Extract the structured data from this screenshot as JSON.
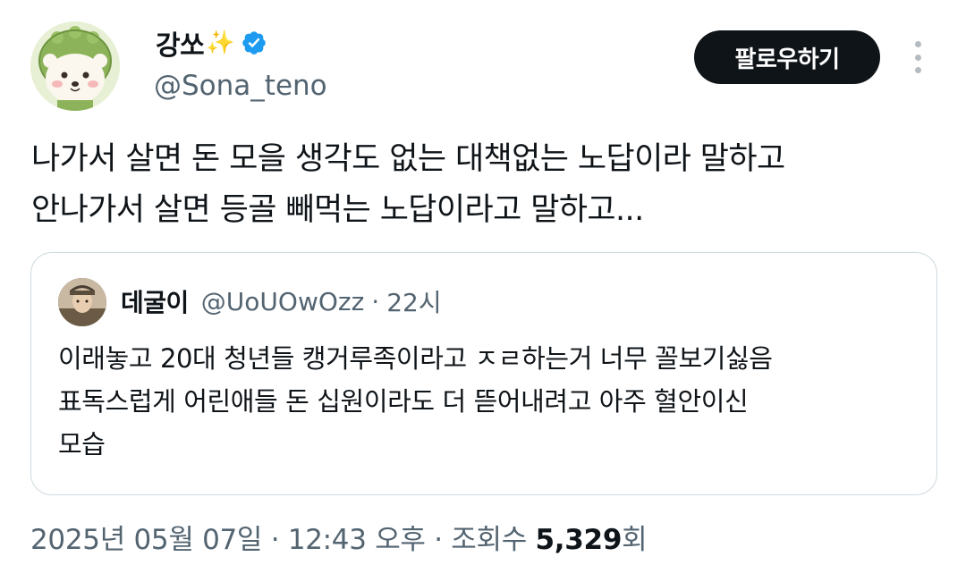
{
  "author": {
    "display_name": "강쏘",
    "sparkle_emoji": "✨",
    "handle": "@Sona_teno",
    "verified": true,
    "follow_label": "팔로우하기"
  },
  "tweet": {
    "lines": [
      "나가서 살면 돈 모을 생각도 없는 대책없는 노답이라 말하고",
      "안나가서 살면 등골 빼먹는 노답이라고 말하고..."
    ]
  },
  "quote": {
    "display_name": "데굴이",
    "handle": "@UoUOwOzz",
    "separator": "·",
    "time": "22시",
    "lines": [
      "이래놓고 20대 청년들 캥거루족이라고 ㅈㄹ하는거 너무 꼴보기싫음",
      "표독스럽게 어린애들 돈 십원이라도 더 뜯어내려고 아주 혈안이신",
      "모습"
    ]
  },
  "meta": {
    "datetime": "2025년 05월 07일 · 12:43 오후 · 조회수 ",
    "views": "5,329",
    "views_suffix": "회"
  },
  "colors": {
    "verified_blue": "#1d9bf0",
    "follow_bg": "#0f1419",
    "secondary_text": "#536471",
    "border": "#cfd9de"
  }
}
